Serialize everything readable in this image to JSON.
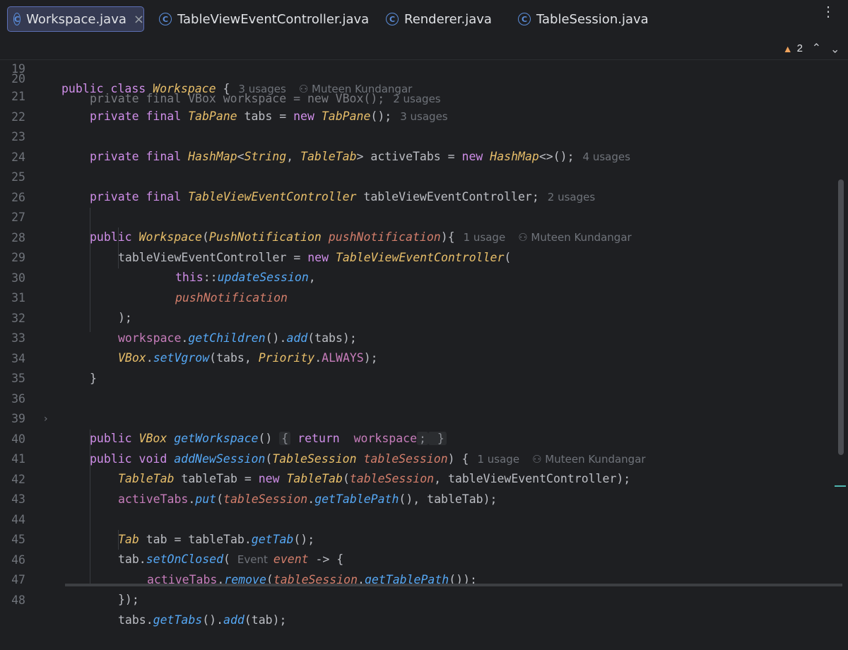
{
  "tabs": [
    {
      "label": "Workspace.java",
      "icon": "class-icon",
      "active": true
    },
    {
      "label": "TableViewEventController.java",
      "icon": "class-icon"
    },
    {
      "label": "Renderer.java",
      "icon": "class-icon"
    },
    {
      "label": "TableSession.java",
      "icon": "class-icon"
    }
  ],
  "close_symbol": "×",
  "icon_letter": "C",
  "menu_symbol": "⋮",
  "problems": {
    "count": "2"
  },
  "lines": [
    {
      "n": "19",
      "author": "Muteen Kundangar",
      "hint": "3 usages"
    },
    {
      "n": "20"
    },
    {
      "n": "21",
      "hint": "3 usages"
    },
    {
      "n": "22"
    },
    {
      "n": "23",
      "hint": "4 usages"
    },
    {
      "n": "24"
    },
    {
      "n": "25",
      "hint": "2 usages"
    },
    {
      "n": "26"
    },
    {
      "n": "27",
      "hint": "1 usage",
      "author": "Muteen Kundangar"
    },
    {
      "n": "28"
    },
    {
      "n": "29"
    },
    {
      "n": "30"
    },
    {
      "n": "31"
    },
    {
      "n": "32"
    },
    {
      "n": "33"
    },
    {
      "n": "34"
    },
    {
      "n": "35"
    },
    {
      "n": "36"
    },
    {
      "n": "39"
    },
    {
      "n": "40",
      "hint": "1 usage",
      "author": "Muteen Kundangar"
    },
    {
      "n": "41"
    },
    {
      "n": "42"
    },
    {
      "n": "43"
    },
    {
      "n": "44"
    },
    {
      "n": "45",
      "hint": "Event"
    },
    {
      "n": "46"
    },
    {
      "n": "47"
    },
    {
      "n": "48"
    }
  ],
  "code": {
    "l19": [
      "public class ",
      "Workspace",
      " {"
    ],
    "l20": [
      "private final VBox workspace = new VBox();",
      "2 usages"
    ],
    "l21": [
      "private final ",
      "TabPane",
      " tabs = ",
      "new ",
      "TabPane",
      "();"
    ],
    "l23": [
      "private final ",
      "HashMap",
      "<",
      "String",
      ", ",
      "TableTab",
      "> activeTabs = ",
      "new ",
      "HashMap",
      "<>();"
    ],
    "l25": [
      "private final ",
      "TableViewEventController",
      " tableViewEventController;"
    ],
    "l27": [
      "public ",
      "Workspace",
      "(",
      "PushNotification",
      " ",
      "pushNotification",
      "){"
    ],
    "l28": [
      "tableViewEventController = ",
      "new ",
      "TableViewEventController",
      "("
    ],
    "l29": [
      "this",
      "::",
      "updateSession",
      ","
    ],
    "l30": [
      "pushNotification"
    ],
    "l31": [
      ");"
    ],
    "l32": [
      "workspace",
      ".",
      "getChildren",
      "().",
      "add",
      "(tabs);"
    ],
    "l33": [
      "VBox",
      ".",
      "setVgrow",
      "(tabs, ",
      "Priority",
      ".",
      "ALWAYS",
      ");"
    ],
    "l34": [
      "}"
    ],
    "l36": [
      "public ",
      "VBox",
      " ",
      "getWorkspace",
      "() ",
      "{",
      " return ",
      "workspace",
      ";",
      " }"
    ],
    "l40": [
      "public void ",
      "addNewSession",
      "(",
      "TableSession",
      " ",
      "tableSession",
      ") {"
    ],
    "l41": [
      "TableTab",
      " tableTab = ",
      "new ",
      "TableTab",
      "(",
      "tableSession",
      ", tableViewEventController);"
    ],
    "l42": [
      "activeTabs",
      ".",
      "put",
      "(",
      "tableSession",
      ".",
      "getTablePath",
      "(), tableTab);"
    ],
    "l44": [
      "Tab",
      " tab = tableTab.",
      "getTab",
      "();"
    ],
    "l45": [
      "tab.",
      "setOnClosed",
      "( ",
      "event",
      " -> {"
    ],
    "l46": [
      "activeTabs",
      ".",
      "remove",
      "(",
      "tableSession",
      ".",
      "getTablePath",
      "());"
    ],
    "l47": [
      "});"
    ],
    "l48": [
      "tabs.",
      "getTabs",
      "().",
      "add",
      "(tab);"
    ]
  }
}
